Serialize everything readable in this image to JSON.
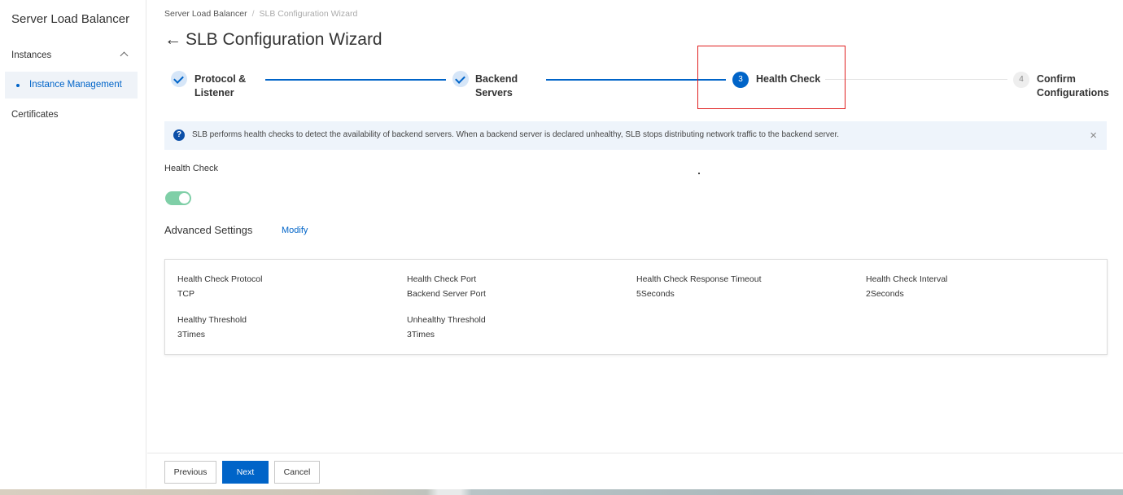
{
  "sidebar": {
    "title": "Server Load Balancer",
    "group_label": "Instances",
    "active_item": "Instance Management",
    "certificates": "Certificates"
  },
  "breadcrumb": {
    "root": "Server Load Balancer",
    "separator": "/",
    "current": "SLB Configuration Wizard"
  },
  "header": {
    "back_glyph": "←",
    "title": "SLB Configuration Wizard"
  },
  "steps": [
    {
      "line1": "Protocol &",
      "line2": "Listener",
      "state": "done"
    },
    {
      "line1": "Backend",
      "line2": "Servers",
      "state": "done"
    },
    {
      "number": "3",
      "label": "Health Check",
      "state": "active"
    },
    {
      "number": "4",
      "line1": "Confirm",
      "line2": "Configurations",
      "state": "pending"
    }
  ],
  "notice": {
    "icon": "?",
    "text": "SLB performs health checks to detect the availability of backend servers. When a backend server is declared unhealthy, SLB stops distributing network traffic to the backend server.",
    "close": "×"
  },
  "health_check": {
    "label": "Health Check",
    "enabled": true
  },
  "advanced": {
    "label": "Advanced Settings",
    "modify": "Modify"
  },
  "settings": {
    "protocol_label": "Health Check Protocol",
    "protocol_value": "TCP",
    "port_label": "Health Check Port",
    "port_value": "Backend Server Port",
    "timeout_label": "Health Check Response Timeout",
    "timeout_value": "5Seconds",
    "interval_label": "Health Check Interval",
    "interval_value": "2Seconds",
    "healthy_label": "Healthy Threshold",
    "healthy_value": "3Times",
    "unhealthy_label": "Unhealthy Threshold",
    "unhealthy_value": "3Times"
  },
  "footer": {
    "previous": "Previous",
    "next": "Next",
    "cancel": "Cancel"
  },
  "colors": {
    "primary": "#0064c8",
    "toggle_on": "#7fcfa7",
    "highlight": "#e02020",
    "notice_bg": "#eef4fb"
  }
}
